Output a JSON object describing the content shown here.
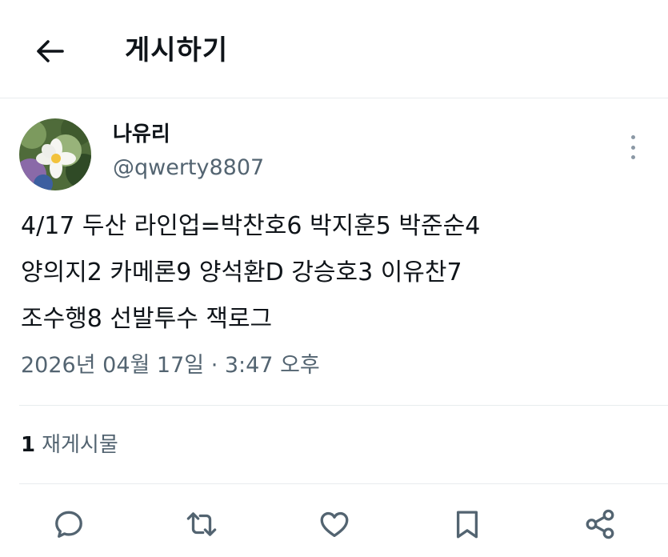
{
  "header": {
    "title": "게시하기",
    "back_icon": "arrow-left-icon"
  },
  "tweet": {
    "author_name": "나유리",
    "handle": "@qwerty8807",
    "text_lines": [
      "4/17 두산 라인업=박찬호6 박지훈5 박준순4",
      "양의지2 카메론9 양석환D 강승호3 이유찬7",
      "조수행8 선발투수 잭로그"
    ],
    "timestamp": "2026년 04월 17일 · 3:47 오후",
    "retweets_count": "1",
    "retweets_label": "재게시물"
  },
  "actions": [
    "reply-icon",
    "retweet-icon",
    "like-icon",
    "bookmark-icon",
    "share-icon"
  ],
  "colors": {
    "text": "#0f1419",
    "secondary": "#536471",
    "divider": "#e8ecee"
  }
}
